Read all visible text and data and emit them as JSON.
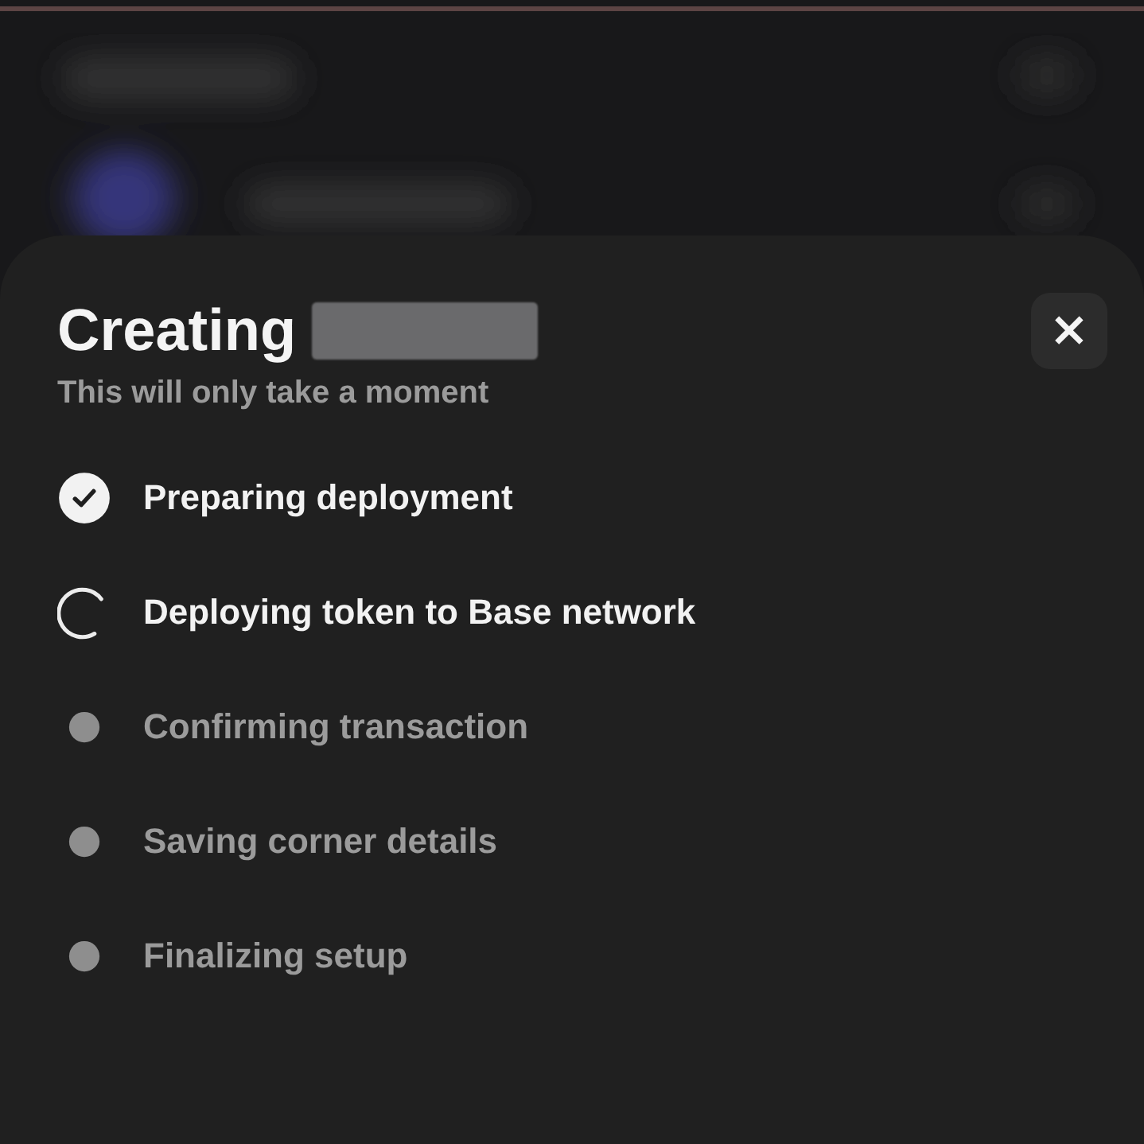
{
  "sheet": {
    "title": "Creating",
    "subtitle": "This will only take a moment",
    "close": "×"
  },
  "steps": [
    {
      "label": "Preparing deployment",
      "kind": "done"
    },
    {
      "label": "Deploying token to Base network",
      "kind": "active"
    },
    {
      "label": "Confirming transaction",
      "kind": "pending"
    },
    {
      "label": "Saving corner details",
      "kind": "pending"
    },
    {
      "label": "Finalizing setup",
      "kind": "pending"
    }
  ]
}
